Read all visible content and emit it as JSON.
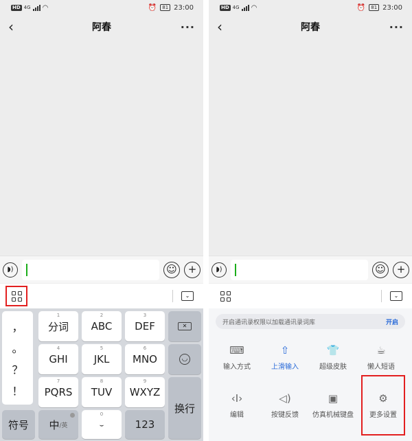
{
  "status": {
    "hd": "HD",
    "network": "4G",
    "battery": "81",
    "time": "23:00"
  },
  "chat": {
    "title": "阿春"
  },
  "keyboard": {
    "punctuation": [
      "，",
      "。",
      "？",
      "！"
    ],
    "letters": [
      {
        "num": "1",
        "label": "分词"
      },
      {
        "num": "2",
        "label": "ABC"
      },
      {
        "num": "3",
        "label": "DEF"
      },
      {
        "num": "4",
        "label": "GHI"
      },
      {
        "num": "5",
        "label": "JKL"
      },
      {
        "num": "6",
        "label": "MNO"
      },
      {
        "num": "7",
        "label": "PQRS"
      },
      {
        "num": "8",
        "label": "TUV"
      },
      {
        "num": "9",
        "label": "WXYZ"
      }
    ],
    "zero_num": "0",
    "symbol_key": "符号",
    "lang_key": "中",
    "lang_alt": "/英",
    "numbers_key": "123",
    "enter_key": "换行"
  },
  "panel": {
    "notice_text": "开启通讯录权限以加载通讯录词库",
    "notice_action": "开启",
    "tools": [
      {
        "label": "输入方式",
        "icon": "keyboard-icon"
      },
      {
        "label": "上滑输入",
        "icon": "swipe-up-input-icon"
      },
      {
        "label": "超级皮肤",
        "icon": "tshirt-icon"
      },
      {
        "label": "懒人短语",
        "icon": "quick-phrase-icon"
      },
      {
        "label": "编辑",
        "icon": "text-cursor-icon"
      },
      {
        "label": "按键反馈",
        "icon": "key-feedback-icon"
      },
      {
        "label": "仿真机械键盘",
        "icon": "mechanical-keyboard-icon"
      },
      {
        "label": "更多设置",
        "icon": "gear-icon"
      }
    ]
  }
}
